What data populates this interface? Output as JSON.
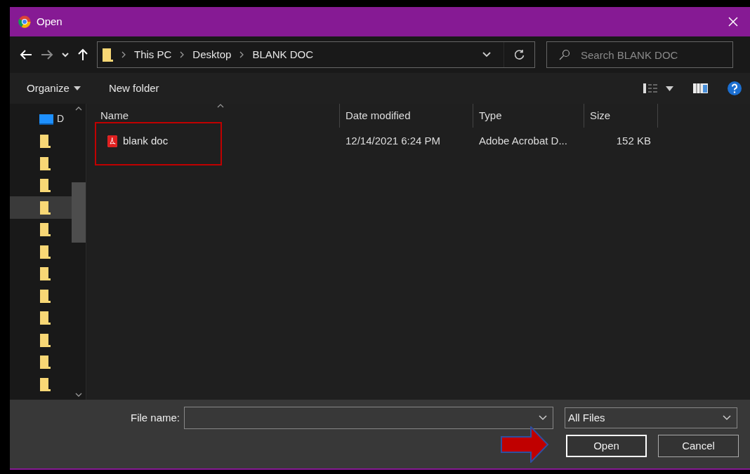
{
  "window": {
    "title": "Open"
  },
  "address": {
    "crumbs": [
      "This PC",
      "Desktop",
      "BLANK DOC"
    ]
  },
  "search": {
    "placeholder": "Search BLANK DOC"
  },
  "toolbar": {
    "organize": "Organize",
    "new_folder": "New folder"
  },
  "sidebar": {
    "items": [
      {
        "label": "D",
        "kind": "drive",
        "selected": false
      },
      {
        "kind": "folder",
        "selected": false
      },
      {
        "kind": "folder",
        "selected": false
      },
      {
        "kind": "folder",
        "selected": false
      },
      {
        "kind": "folder",
        "selected": true
      },
      {
        "kind": "folder",
        "selected": false
      },
      {
        "kind": "folder",
        "selected": false
      },
      {
        "kind": "folder",
        "selected": false
      },
      {
        "kind": "folder",
        "selected": false
      },
      {
        "kind": "folder",
        "selected": false
      },
      {
        "kind": "folder",
        "selected": false
      },
      {
        "kind": "folder",
        "selected": false
      },
      {
        "kind": "folder",
        "selected": false
      }
    ]
  },
  "table": {
    "columns": [
      "Name",
      "Date modified",
      "Type",
      "Size"
    ],
    "rows": [
      {
        "name": "blank doc",
        "date": "12/14/2021 6:24 PM",
        "type": "Adobe Acrobat D...",
        "size": "152 KB",
        "highlighted": true
      }
    ]
  },
  "footer": {
    "file_name_label": "File name:",
    "file_type": "All Files",
    "buttons": [
      {
        "label": "Open",
        "default": true
      },
      {
        "label": "Cancel",
        "default": false
      }
    ]
  }
}
